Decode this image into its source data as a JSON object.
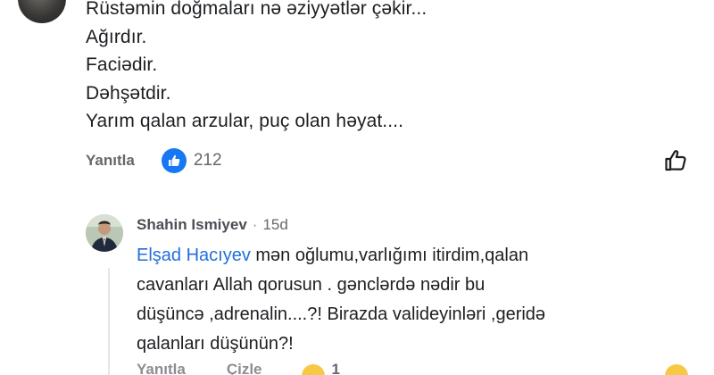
{
  "main_comment": {
    "lines": [
      "Rüstəmin doğmaları nə əziyyətlər çəkir...",
      "Ağırdır.",
      "Faciədir.",
      "Dəhşətdir.",
      "Yarım qalan arzular, puç olan həyat...."
    ],
    "reply_label": "Yanıtla",
    "reaction_count": "212",
    "reaction_icon": "like-icon",
    "like_action_icon": "thumbs-up-outline-icon"
  },
  "reply": {
    "author": "Shahin Ismiyev",
    "separator": "·",
    "timestamp": "15d",
    "mention": "Elşad Hacıyev",
    "line1_rest": " mən oğlumu,varlığımı itirdim,qalan",
    "line2": "cavanları Allah qorusun . gənclərdə nədir bu",
    "line3": "düşüncə ,adrenalin....?! Birazda valideyinləri ,geridə",
    "line4": "qalanları düşünün?!",
    "cut_reply_label": "Yanıtla",
    "cut_second_label": "Çizle",
    "cut_count": "1",
    "colors": {
      "mention": "#216fdb",
      "like_blue": "#1877f2",
      "muted": "#65676b"
    }
  }
}
